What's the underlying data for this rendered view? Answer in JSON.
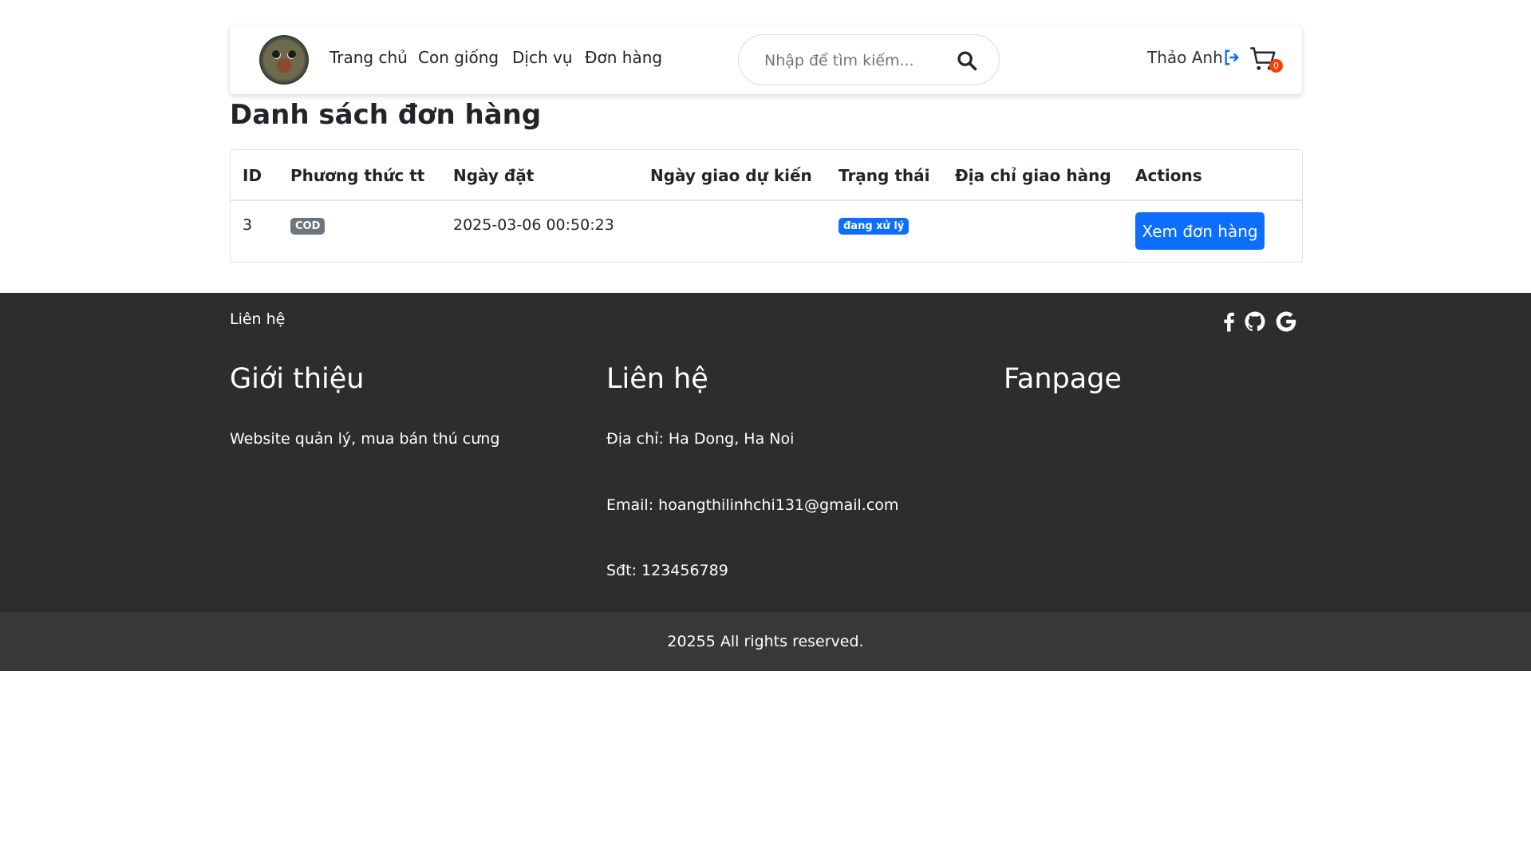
{
  "nav": {
    "links": [
      "Trang chủ",
      "Con giống",
      "Dịch vụ",
      "Đơn hàng"
    ],
    "search_placeholder": "Nhập để tìm kiếm...",
    "user_name": "Thảo Anh",
    "cart_count": "0"
  },
  "page": {
    "title": "Danh sách đơn hàng"
  },
  "orders_table": {
    "headers": [
      "ID",
      "Phương thức tt",
      "Ngày đặt",
      "Ngày giao dự kiến",
      "Trạng thái",
      "Địa chỉ giao hàng",
      "Actions"
    ],
    "rows": [
      {
        "id": "3",
        "payment": "COD",
        "order_date": "2025-03-06 00:50:23",
        "expected_delivery": "",
        "status": "đang xử lý",
        "address": "",
        "action_label": "Xem đơn hàng"
      }
    ]
  },
  "footer": {
    "top_label": "Liên hệ",
    "social_icons": [
      "facebook-icon",
      "github-icon",
      "google-icon"
    ],
    "intro_title": "Giới thiệu",
    "intro_text": "Website quản lý, mua bán thú cưng",
    "contact_title": "Liên hệ",
    "address": "Địa chỉ: Ha Dong, Ha Noi",
    "email": "Email: hoangthilinhchi131@gmail.com",
    "phone": "Sđt: 123456789",
    "fanpage_title": "Fanpage",
    "copyright": "20255 All rights reserved."
  },
  "colors": {
    "primary": "#0d6efd",
    "badge_gray": "#6c757d",
    "cart_badge": "#fd3d00",
    "footer_bg": "#2d2d2d",
    "copyright_bg": "#383838"
  }
}
